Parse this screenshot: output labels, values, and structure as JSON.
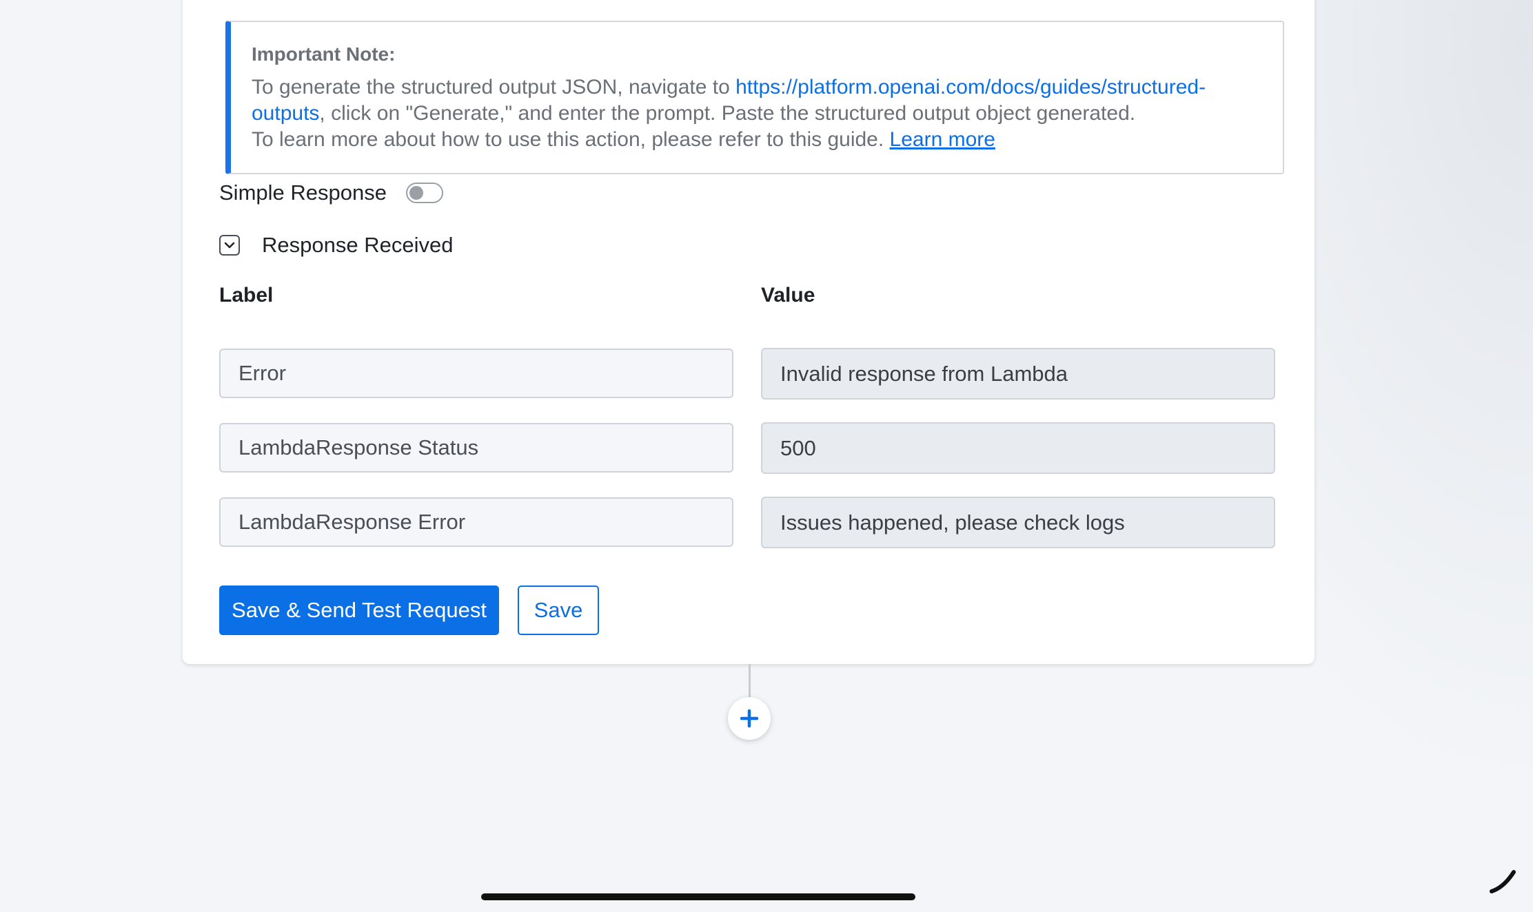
{
  "note": {
    "title": "Important Note:",
    "text_before_link": "To generate the structured output JSON, navigate to ",
    "link_url_text": "https://platform.openai.com/docs/guides/structured-outputs",
    "text_after_link": ", click on \"Generate,\" and enter the prompt. Paste the structured output object generated.",
    "guide_text": "To learn more about how to use this action, please refer to this guide. ",
    "learn_more": "Learn more"
  },
  "simple_response": {
    "label": "Simple Response",
    "enabled": false
  },
  "response_received": {
    "label": "Response Received",
    "icon": "chevron-down-icon"
  },
  "columns": {
    "label": "Label",
    "value": "Value"
  },
  "rows": [
    {
      "label": "Error",
      "value": "Invalid response from Lambda"
    },
    {
      "label": "LambdaResponse Status",
      "value": "500"
    },
    {
      "label": "LambdaResponse Error",
      "value": "Issues happened, please check logs"
    }
  ],
  "buttons": {
    "primary": "Save & Send Test Request",
    "secondary": "Save"
  },
  "add_step": {
    "icon": "plus-icon"
  },
  "colors": {
    "accent": "#0b6fe6",
    "note_border": "#1a73e8"
  }
}
